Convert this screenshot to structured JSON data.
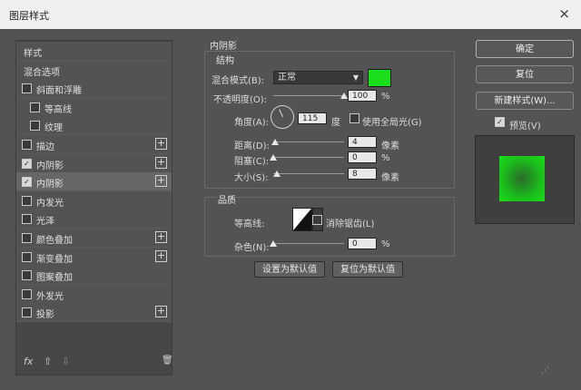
{
  "window": {
    "title": "图层样式",
    "close": "×"
  },
  "left_panel": {
    "items": [
      {
        "label": "样式",
        "checkbox": null,
        "plus": false
      },
      {
        "label": "混合选项",
        "checkbox": null,
        "plus": false
      },
      {
        "label": "斜面和浮雕",
        "checkbox": false,
        "plus": false
      },
      {
        "label": "等高线",
        "checkbox": false,
        "plus": false
      },
      {
        "label": "纹理",
        "checkbox": false,
        "plus": false
      },
      {
        "label": "描边",
        "checkbox": false,
        "plus": true
      },
      {
        "label": "内阴影",
        "checkbox": true,
        "plus": true
      },
      {
        "label": "内阴影",
        "checkbox": true,
        "plus": true
      },
      {
        "label": "内发光",
        "checkbox": false,
        "plus": false
      },
      {
        "label": "光泽",
        "checkbox": false,
        "plus": false
      },
      {
        "label": "颜色叠加",
        "checkbox": false,
        "plus": true
      },
      {
        "label": "渐变叠加",
        "checkbox": false,
        "plus": true
      },
      {
        "label": "图案叠加",
        "checkbox": false,
        "plus": false
      },
      {
        "label": "外发光",
        "checkbox": false,
        "plus": false
      },
      {
        "label": "投影",
        "checkbox": false,
        "plus": true
      }
    ],
    "footer": {
      "fx": "fx",
      "up": "⇧",
      "down": "⇩",
      "trash": "🗑"
    }
  },
  "inner_shadow": {
    "section_title": "内阴影",
    "structure_title": "结构",
    "blend_mode_label": "混合模式(B):",
    "blend_mode_value": "正常",
    "color": "#1adf1a",
    "opacity_label": "不透明度(O):",
    "opacity_value": "100",
    "opacity_unit": "%",
    "opacity_level": 1.0,
    "angle_label": "角度(A):",
    "angle_value": "115",
    "angle_unit": "度",
    "global_light_label": "使用全局光(G)",
    "global_light_checked": false,
    "distance_label": "距离(D):",
    "distance_value": "4",
    "distance_unit": "像素",
    "distance_level": 0.02,
    "choke_label": "阻塞(C):",
    "choke_value": "0",
    "choke_unit": "%",
    "choke_level": 0.0,
    "size_label": "大小(S):",
    "size_value": "8",
    "size_unit": "像素",
    "size_level": 0.05,
    "quality_title": "品质",
    "contour_label": "等高线:",
    "antialias_label": "消除锯齿(L)",
    "antialias_checked": false,
    "noise_label": "杂色(N):",
    "noise_value": "0",
    "noise_unit": "%",
    "noise_level": 0.0,
    "set_default": "设置为默认值",
    "reset_default": "复位为默认值"
  },
  "right_panel": {
    "ok": "确定",
    "reset": "复位",
    "new_style": "新建样式(W)...",
    "preview_label": "预览(V)",
    "preview_checked": true,
    "preview_color": "#1adf1a"
  }
}
